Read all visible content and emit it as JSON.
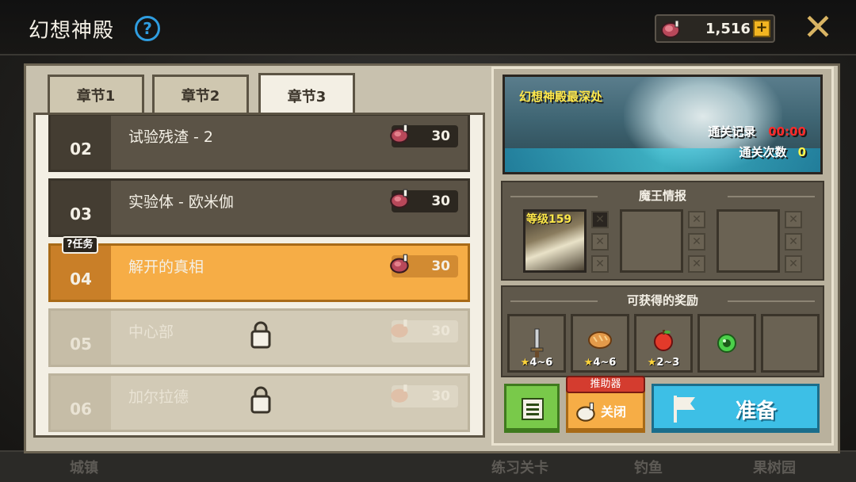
{
  "header": {
    "title": "幻想神殿",
    "help_symbol": "?",
    "meat_amount": "1,516",
    "plus_symbol": "+",
    "close_symbol": "✕"
  },
  "background_labels": [
    "城镇",
    "练习关卡",
    "钓鱼",
    "果树园"
  ],
  "tabs": [
    {
      "label": "章节1",
      "active": false
    },
    {
      "label": "章节2",
      "active": false
    },
    {
      "label": "章节3",
      "active": true
    }
  ],
  "stages": [
    {
      "num": "02",
      "name": "试验残渣 - 2",
      "cost": "30",
      "state": "normal"
    },
    {
      "num": "03",
      "name": "实验体 - 欧米伽",
      "cost": "30",
      "state": "normal"
    },
    {
      "num": "04",
      "name": "解开的真相",
      "cost": "30",
      "state": "current"
    },
    {
      "num": "05",
      "name": "中心部",
      "cost": "30",
      "state": "locked"
    },
    {
      "num": "06",
      "name": "加尔拉德",
      "cost": "30",
      "state": "locked"
    }
  ],
  "quest_tag": "?任务",
  "banner": {
    "title": "幻想神殿最深处",
    "record_label": "通关记录",
    "record_value": "00:00",
    "clears_label": "通关次数",
    "clears_value": "0"
  },
  "boss_section": {
    "title": "魔王情报",
    "boss_level": "等级159"
  },
  "reward_section": {
    "title": "可获得的奖励",
    "rewards": [
      {
        "icon": "sword-icon",
        "amount": "4~6"
      },
      {
        "icon": "bread-icon",
        "amount": "4~6"
      },
      {
        "icon": "apple-icon",
        "amount": "2~3"
      },
      {
        "icon": "green-orb-icon",
        "amount": ""
      },
      {
        "icon": "empty-slot",
        "amount": ""
      }
    ]
  },
  "buttons": {
    "assist_tag": "推助器",
    "assist_label": "关闭",
    "ready_label": "准备"
  },
  "colors": {
    "accent_orange": "#f6ad46",
    "ready_blue": "#3dbfe6",
    "list_green": "#79c94a",
    "help_blue": "#2f9de0",
    "record_red": "#ff2a2a",
    "title_yellow": "#ffe84a"
  }
}
